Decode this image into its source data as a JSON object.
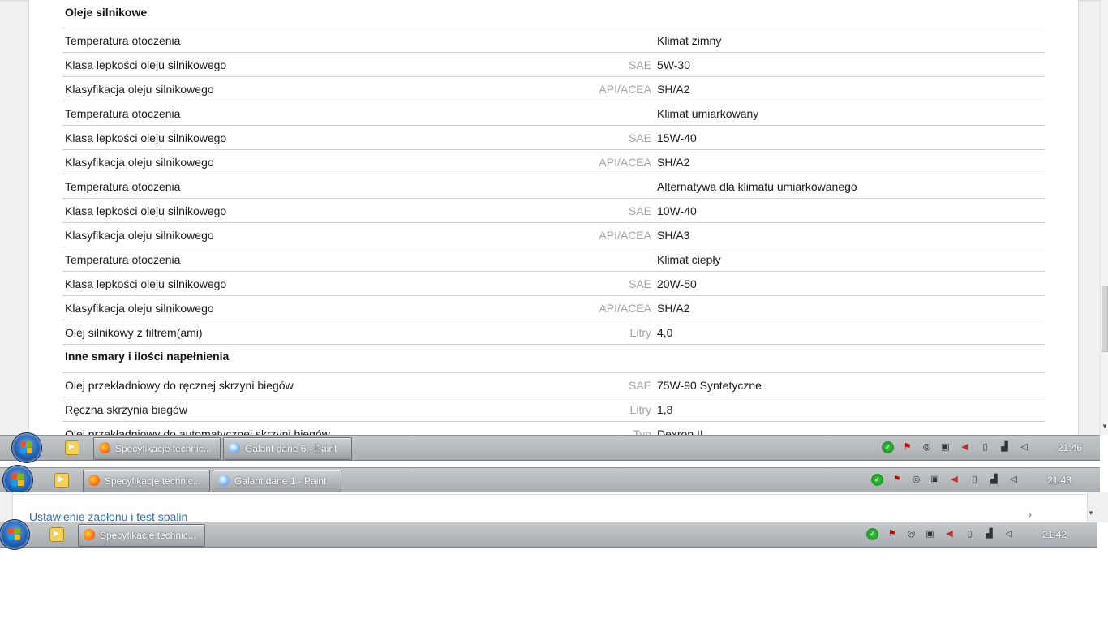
{
  "page": {
    "section1_title": "Oleje silnikowe",
    "rows1": [
      {
        "label": "Temperatura otoczenia",
        "unit": "",
        "value": "Klimat zimny"
      },
      {
        "label": "Klasa lepkości oleju silnikowego",
        "unit": "SAE",
        "value": "5W-30"
      },
      {
        "label": "Klasyfikacja oleju silnikowego",
        "unit": "API/ACEA",
        "value": "SH/A2"
      },
      {
        "label": "Temperatura otoczenia",
        "unit": "",
        "value": "Klimat umiarkowany"
      },
      {
        "label": "Klasa lepkości oleju silnikowego",
        "unit": "SAE",
        "value": "15W-40"
      },
      {
        "label": "Klasyfikacja oleju silnikowego",
        "unit": "API/ACEA",
        "value": "SH/A2"
      },
      {
        "label": "Temperatura otoczenia",
        "unit": "",
        "value": "Alternatywa dla klimatu umiarkowanego"
      },
      {
        "label": "Klasa lepkości oleju silnikowego",
        "unit": "SAE",
        "value": "10W-40"
      },
      {
        "label": "Klasyfikacja oleju silnikowego",
        "unit": "API/ACEA",
        "value": "SH/A3"
      },
      {
        "label": "Temperatura otoczenia",
        "unit": "",
        "value": "Klimat ciepły"
      },
      {
        "label": "Klasa lepkości oleju silnikowego",
        "unit": "SAE",
        "value": "20W-50"
      },
      {
        "label": "Klasyfikacja oleju silnikowego",
        "unit": "API/ACEA",
        "value": "SH/A2"
      },
      {
        "label": "Olej silnikowy z filtrem(ami)",
        "unit": "Litry",
        "value": "4,0"
      }
    ],
    "section2_title": "Inne smary i ilości napełnienia",
    "rows2": [
      {
        "label": "Olej przekładniowy do ręcznej skrzyni biegów",
        "unit": "SAE",
        "value": "75W-90 Syntetyczne"
      },
      {
        "label": "Ręczna skrzynia biegów",
        "unit": "Litry",
        "value": "1,8"
      },
      {
        "label": "Olej przekładniowy do automatycznej skrzyni biegów",
        "unit": "Typ",
        "value": "Dexron II"
      }
    ]
  },
  "taskbar1": {
    "tasks": [
      {
        "label": "Specyfikacje technic...",
        "icon": "firefox-icon"
      },
      {
        "label": "Galant dane 6 - Paint",
        "icon": "paint-icon"
      }
    ],
    "clock": "21:46"
  },
  "taskbar2": {
    "tasks": [
      {
        "label": "Specyfikacje technic...",
        "icon": "firefox-icon"
      },
      {
        "label": "Galant dane 1 - Paint",
        "icon": "paint-icon"
      }
    ],
    "clock": "21:43"
  },
  "strip": {
    "link": "Ustawienie zapłonu i test spalin"
  },
  "taskbar3": {
    "tasks": [
      {
        "label": "Specyfikacje technic...",
        "icon": "firefox-icon"
      }
    ],
    "clock": "21:42"
  },
  "colors": {
    "taskbar": "#a9adb1",
    "link": "#2b6cb0",
    "unit_text": "#a3a3a3",
    "row_border": "#cfcfcf"
  }
}
